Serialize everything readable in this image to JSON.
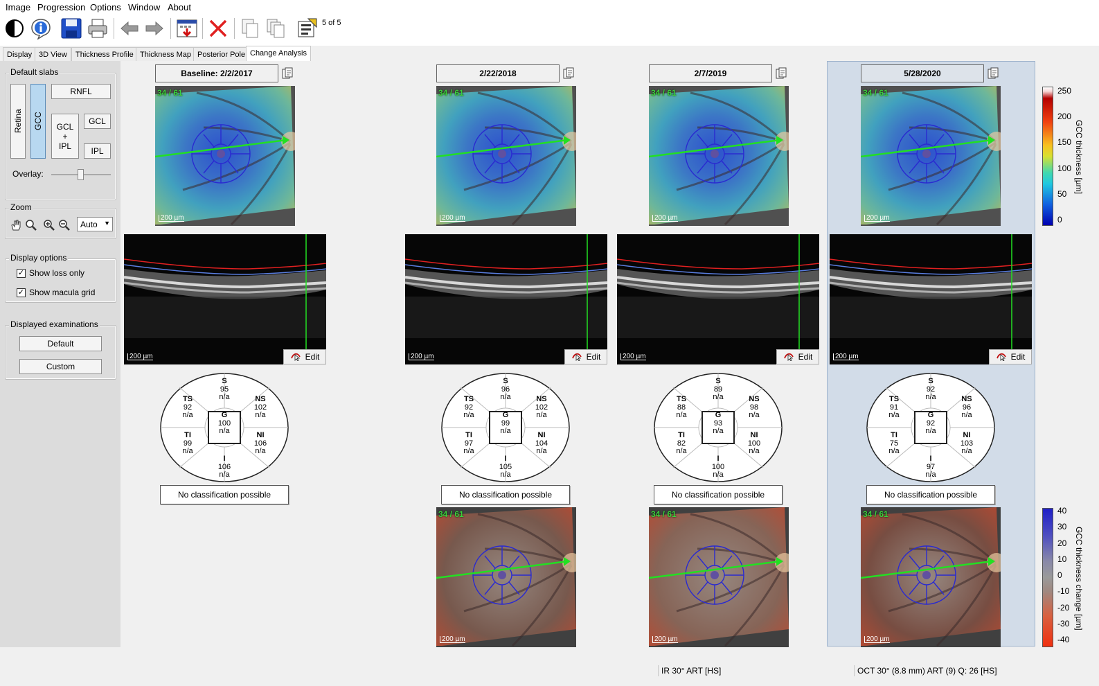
{
  "menu": [
    "Image",
    "Progression",
    "Options",
    "Window",
    "About"
  ],
  "toolbar": {
    "counter": "5 of 5",
    "icons": [
      "contrast-icon",
      "info-icon",
      "save-icon",
      "print-icon",
      "back-arrow-icon",
      "forward-arrow-icon",
      "export-icon",
      "delete-icon",
      "copy-icon",
      "copy-all-icon",
      "report-icon"
    ]
  },
  "tabs": [
    "Display",
    "3D View",
    "Thickness Profile",
    "Thickness Map",
    "Posterior Pole",
    "Change Analysis"
  ],
  "active_tab": "Change Analysis",
  "sidebar": {
    "slabs": {
      "title": "Default slabs",
      "retina": "Retina",
      "gcc": "GCC",
      "rnfl": "RNFL",
      "gcl_ipl": [
        "GCL",
        "+",
        "IPL"
      ],
      "gcl": "GCL",
      "ipl": "IPL",
      "overlay": "Overlay:"
    },
    "zoom": {
      "title": "Zoom",
      "select_value": "Auto"
    },
    "display_options": {
      "title": "Display options",
      "show_loss_only": "Show loss only",
      "show_macula_grid": "Show macula grid",
      "show_loss_only_checked": true,
      "show_macula_grid_checked": true
    },
    "displayed_exams": {
      "title": "Displayed examinations",
      "default": "Default",
      "custom": "Custom"
    }
  },
  "columns": [
    {
      "date": "Baseline: 2/2/2017",
      "fundus_label": "34 / 61",
      "scale": "200 µm",
      "edit": "Edit",
      "sectors": {
        "S": [
          "S",
          "95",
          "n/a"
        ],
        "NS": [
          "NS",
          "102",
          "n/a"
        ],
        "TS": [
          "TS",
          "92",
          "n/a"
        ],
        "G": [
          "G",
          "100",
          "n/a"
        ],
        "TI": [
          "TI",
          "99",
          "n/a"
        ],
        "NI": [
          "NI",
          "106",
          "n/a"
        ],
        "I": [
          "I",
          "106",
          "n/a"
        ]
      },
      "classification": "No classification possible"
    },
    {
      "date": "2/22/2018",
      "fundus_label": "34 / 61",
      "scale": "200 µm",
      "edit": "Edit",
      "sectors": {
        "S": [
          "S",
          "96",
          "n/a"
        ],
        "NS": [
          "NS",
          "102",
          "n/a"
        ],
        "TS": [
          "TS",
          "92",
          "n/a"
        ],
        "G": [
          "G",
          "99",
          "n/a"
        ],
        "TI": [
          "TI",
          "97",
          "n/a"
        ],
        "NI": [
          "NI",
          "104",
          "n/a"
        ],
        "I": [
          "I",
          "105",
          "n/a"
        ]
      },
      "classification": "No classification possible",
      "change_label": "34 / 61"
    },
    {
      "date": "2/7/2019",
      "fundus_label": "34 / 61",
      "scale": "200 µm",
      "edit": "Edit",
      "sectors": {
        "S": [
          "S",
          "89",
          "n/a"
        ],
        "NS": [
          "NS",
          "98",
          "n/a"
        ],
        "TS": [
          "TS",
          "88",
          "n/a"
        ],
        "G": [
          "G",
          "93",
          "n/a"
        ],
        "TI": [
          "TI",
          "82",
          "n/a"
        ],
        "NI": [
          "NI",
          "100",
          "n/a"
        ],
        "I": [
          "I",
          "100",
          "n/a"
        ]
      },
      "classification": "No classification possible",
      "change_label": "34 / 61"
    },
    {
      "date": "5/28/2020",
      "fundus_label": "34 / 61",
      "scale": "200 µm",
      "edit": "Edit",
      "sectors": {
        "S": [
          "S",
          "92",
          "n/a"
        ],
        "NS": [
          "NS",
          "96",
          "n/a"
        ],
        "TS": [
          "TS",
          "91",
          "n/a"
        ],
        "G": [
          "G",
          "92",
          "n/a"
        ],
        "TI": [
          "TI",
          "75",
          "n/a"
        ],
        "NI": [
          "NI",
          "103",
          "n/a"
        ],
        "I": [
          "I",
          "97",
          "n/a"
        ]
      },
      "classification": "No classification possible",
      "change_label": "34 / 61",
      "selected": true
    }
  ],
  "thickness_colorbar": {
    "title": "GCC thickness [µm]",
    "ticks": [
      "250",
      "200",
      "150",
      "100",
      "50",
      "0"
    ]
  },
  "change_colorbar": {
    "title": "GCC thickness change [µm]",
    "ticks": [
      "40",
      "30",
      "20",
      "10",
      "0",
      "-10",
      "-20",
      "-30",
      "-40"
    ]
  },
  "status": {
    "left": "IR 30° ART [HS]",
    "right": "OCT 30° (8.8 mm) ART (9) Q: 26 [HS]"
  },
  "colors": {
    "selected_column": "#d2dce8",
    "fundus_label": "#3bd23b",
    "scan_line": "#22e022",
    "ilm_line": "#e02020",
    "ipl_line": "#5a7ee0",
    "macula_grid": "#2a2ad0"
  }
}
